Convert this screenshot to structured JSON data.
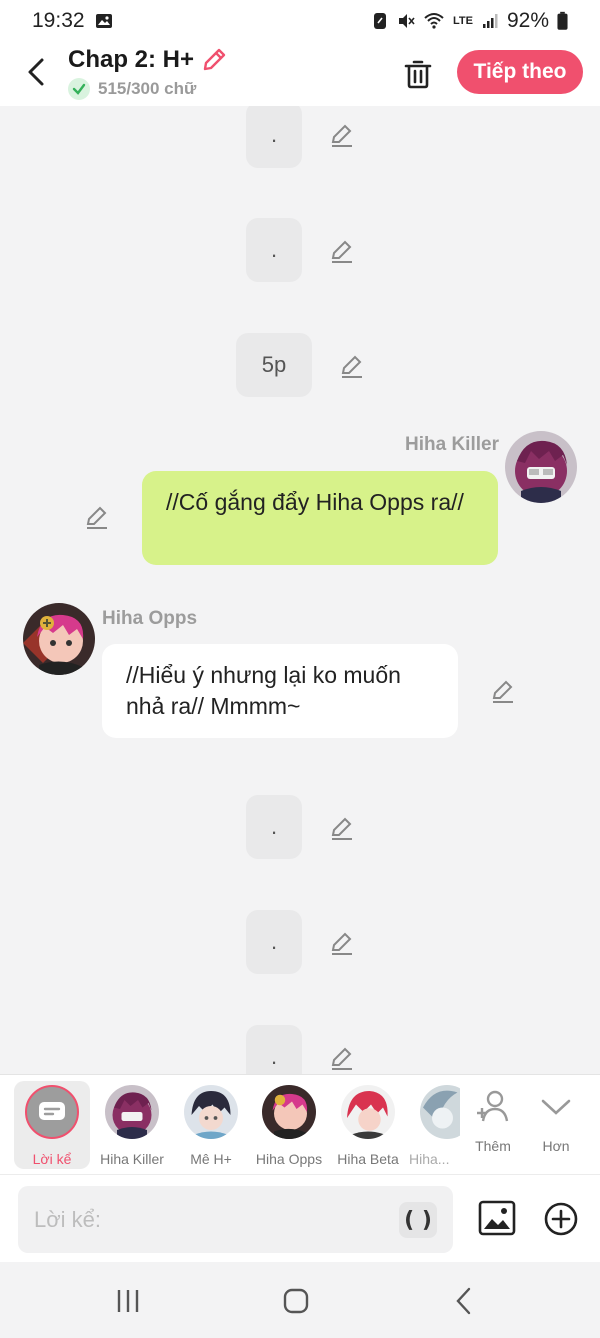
{
  "status": {
    "time": "19:32",
    "battery": "92%",
    "network": "LTE"
  },
  "header": {
    "title": "Chap 2: H+",
    "word_count": "515/300 chữ",
    "next_label": "Tiếp theo",
    "accent_color": "#f0506e"
  },
  "messages": [
    {
      "type": "narration",
      "text": "."
    },
    {
      "type": "narration",
      "text": "."
    },
    {
      "type": "narration",
      "text": "5p"
    },
    {
      "type": "dialogue",
      "side": "right",
      "speaker": "Hiha Killer",
      "text": "//Cố gắng đẩy Hiha Opps ra//",
      "color": "#d7f28a"
    },
    {
      "type": "dialogue",
      "side": "left",
      "speaker": "Hiha Opps",
      "text": "//Hiểu ý nhưng lại ko muốn nhả ra// Mmmm~",
      "color": "#ffffff"
    },
    {
      "type": "narration",
      "text": "."
    },
    {
      "type": "narration",
      "text": "."
    },
    {
      "type": "narration",
      "text": "."
    }
  ],
  "characters": [
    {
      "label": "Lời kể",
      "selected": true
    },
    {
      "label": "Hiha Killer"
    },
    {
      "label": "Mê H+"
    },
    {
      "label": "Hiha Opps"
    },
    {
      "label": "Hiha Beta"
    },
    {
      "label": "Hiha..."
    }
  ],
  "char_actions": {
    "add_label": "Thêm",
    "more_label": "Hơn"
  },
  "input": {
    "placeholder": "Lời kể:",
    "paren_label": "( )"
  }
}
